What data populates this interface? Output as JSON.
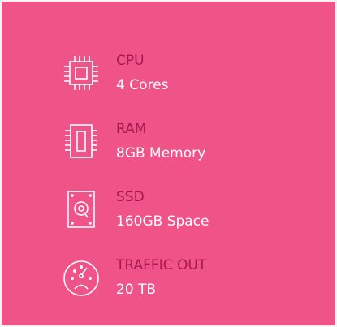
{
  "specs": [
    {
      "label": "CPU",
      "value": "4 Cores",
      "icon": "cpu-chip-icon"
    },
    {
      "label": "RAM",
      "value": "8GB Memory",
      "icon": "ram-module-icon"
    },
    {
      "label": "SSD",
      "value": "160GB Space",
      "icon": "disk-drive-icon"
    },
    {
      "label": "TRAFFIC OUT",
      "value": "20 TB",
      "icon": "speedometer-icon"
    }
  ],
  "colors": {
    "background": "#f05387",
    "label": "#a6194c",
    "value": "#ffffff",
    "icon_stroke": "#ffffff"
  }
}
